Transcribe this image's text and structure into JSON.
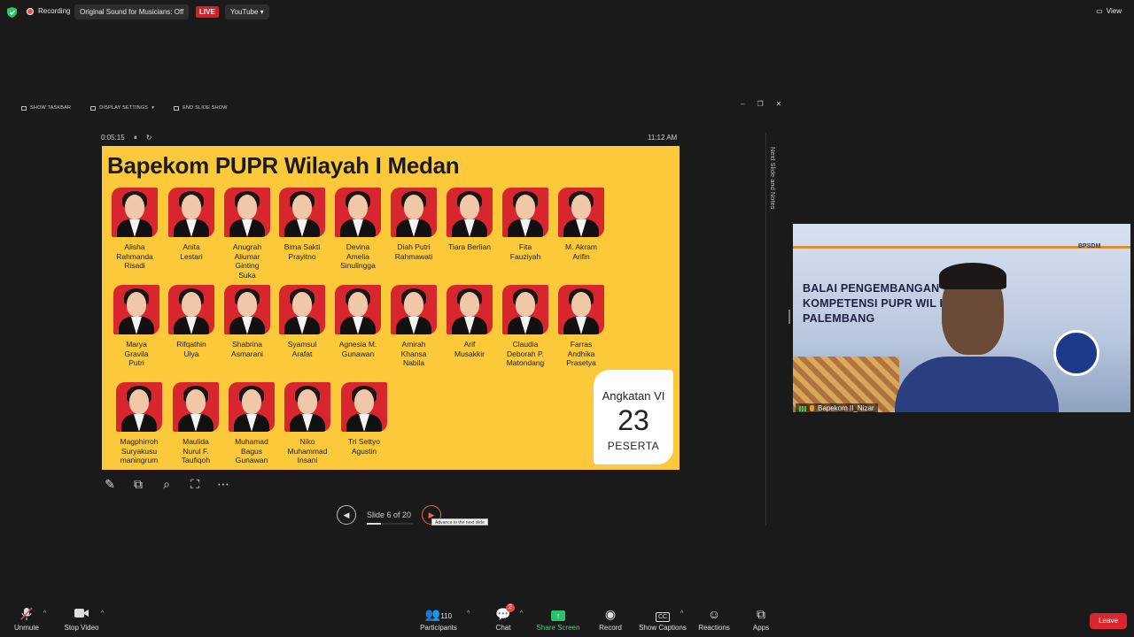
{
  "topbar": {
    "recording_label": "Recording",
    "original_sound": "Original Sound for Musicians: Off",
    "live_badge": "LIVE",
    "stream_target": "YouTube",
    "view_label": "View"
  },
  "presenter_toolbar": {
    "show_taskbar": "SHOW TASKBAR",
    "display_settings": "DISPLAY SETTINGS",
    "end_slide_show": "END SLIDE SHOW"
  },
  "presenter": {
    "elapsed": "0:05:15",
    "clock": "11:12 AM",
    "slide_label": "Slide 6 of 20",
    "tooltip": "Advance to the next slide",
    "side_panel": "Next Slide and Notes",
    "progress_fraction": 0.3
  },
  "slide": {
    "title": "Bapekom PUPR Wilayah I Medan",
    "people": [
      [
        "Alisha",
        "Rahmanda",
        "Risadi"
      ],
      [
        "Anita",
        "Lestari"
      ],
      [
        "Anugrah",
        "Aliumar",
        "Ginting",
        "Suka"
      ],
      [
        "Bima Sakti",
        "Prayitno"
      ],
      [
        "Devina",
        "Amelia",
        "Sinulingga"
      ],
      [
        "Diah Putri",
        "Rahmawati"
      ],
      [
        "Tiara Berlian"
      ],
      [
        "Fita",
        "Fauziyah"
      ],
      [
        "M. Akram",
        "Arifin"
      ],
      [
        "Marya",
        "Gravila",
        "Putri"
      ],
      [
        "Rifqathin",
        "Ulya"
      ],
      [
        "Shabrina",
        "Asmarani"
      ],
      [
        "Syamsul",
        "Arafat"
      ],
      [
        "Agnesia M.",
        "Gunawan"
      ],
      [
        "Amirah",
        "Khansa",
        "Nabila"
      ],
      [
        "Arif",
        "Musakkir"
      ],
      [
        "Claudia",
        "Deborah P.",
        "Matondang"
      ],
      [
        "Farras",
        "Andhika",
        "Prasetya"
      ],
      [
        "Magphirroh",
        "Suryakusu",
        "maningrum"
      ],
      [
        "Maulida",
        "Nurul F.",
        "Taufiqoh"
      ],
      [
        "Muhamad",
        "Bagus",
        "Gunawan"
      ],
      [
        "Niko",
        "Muhammad",
        "Insani"
      ],
      [
        "Tri Settyo",
        "Agustin"
      ]
    ],
    "angkatan": {
      "label": "Angkatan VI",
      "count": "23",
      "unit": "PESERTA"
    }
  },
  "video": {
    "line1": "BALAI PENGEMBANGAN",
    "line2": "KOMPETENSI PUPR WIL II",
    "line3": "PALEMBANG",
    "logo_text": "BPSDM",
    "participant_name": "Bapekom II_Nizar"
  },
  "bottombar": {
    "unmute": "Unmute",
    "stop_video": "Stop Video",
    "participants": "Participants",
    "participants_count": "110",
    "chat": "Chat",
    "chat_badge": "2",
    "share_screen": "Share Screen",
    "record": "Record",
    "show_captions": "Show Captions",
    "reactions": "Reactions",
    "apps": "Apps",
    "leave": "Leave"
  },
  "colors": {
    "slide_bg": "#fcc93a",
    "photo_bg": "#d8262f",
    "live_red": "#d3202b",
    "share_green": "#2ac06e",
    "leave_red": "#d9262f"
  }
}
